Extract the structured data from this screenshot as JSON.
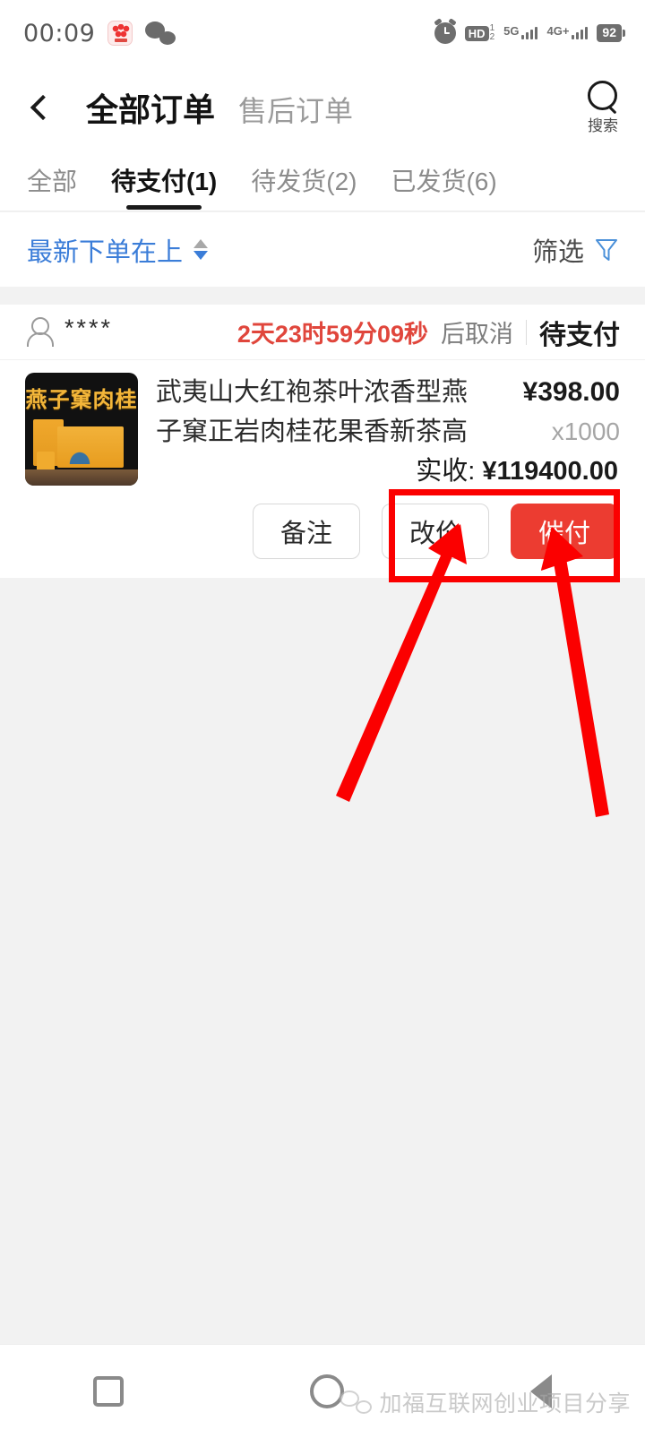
{
  "status_bar": {
    "time": "00:09",
    "app_badge_icon": "red-app-icon",
    "wechat_icon": "wechat-icon",
    "alarm_icon": "alarm-clock-icon",
    "hd_label": "HD",
    "hd_sim_top": "1",
    "hd_sim_bottom": "2",
    "signal_1_label": "5G",
    "signal_2_label": "4G+",
    "battery_level": "92"
  },
  "header": {
    "back_icon": "chevron-left-icon",
    "title": "全部订单",
    "subtitle": "售后订单",
    "search_icon": "search-icon",
    "search_label": "搜索"
  },
  "tabs": [
    {
      "label": "全部",
      "active": false
    },
    {
      "label": "待支付(1)",
      "active": true
    },
    {
      "label": "待发货(2)",
      "active": false
    },
    {
      "label": "已发货(6)",
      "active": false
    }
  ],
  "sort_bar": {
    "sort_label": "最新下单在上",
    "sort_icon": "sort-arrows-icon",
    "filter_label": "筛选",
    "filter_icon": "funnel-icon",
    "accent_color": "#3b7dd8"
  },
  "order": {
    "buyer_icon": "person-icon",
    "buyer_name": "****",
    "countdown": "2天23时59分09秒",
    "countdown_suffix": "后取消",
    "status": "待支付",
    "countdown_color": "#e0463c",
    "product": {
      "thumbnail_icon": "product-thumbnail-tea-gift-box",
      "thumbnail_text": "燕子窠肉桂",
      "title": "武夷山大红袍茶叶浓香型燕子窠正岩肉桂花果香新茶高档…",
      "price": "¥398.00",
      "quantity": "x1000",
      "actual_label": "实收:",
      "actual_amount": "¥119400.00"
    },
    "actions": [
      {
        "label": "备注",
        "style": "ghost"
      },
      {
        "label": "改价",
        "style": "ghost"
      },
      {
        "label": "催付",
        "style": "primary"
      }
    ],
    "primary_color": "#ec3c31"
  },
  "annotation": {
    "highlight_color": "#fb0000",
    "rect_target": "改价-and-催付-buttons",
    "arrow_1_target": "改价",
    "arrow_2_target": "催付"
  },
  "bottom_nav": {
    "recents_icon": "square-recents-icon",
    "home_icon": "circle-home-icon",
    "back_icon": "triangle-back-icon"
  },
  "watermark": {
    "logo_icon": "wechat-icon",
    "text": "加福互联网创业项目分享"
  }
}
